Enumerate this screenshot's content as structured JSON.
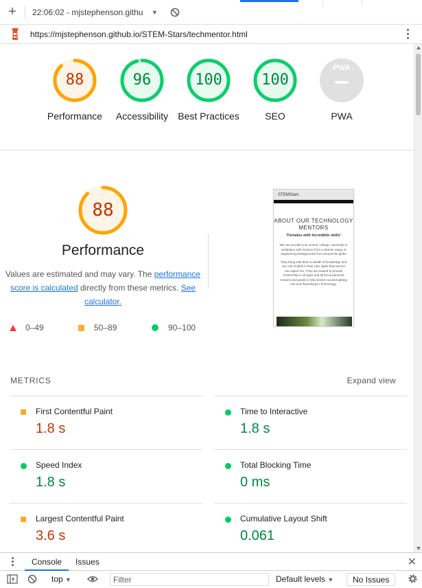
{
  "colors": {
    "orange": "#ffa400",
    "green": "#0cce6b",
    "grey": "#e0e0e0",
    "blue_link": "#1a73e8"
  },
  "toolbar": {
    "add_icon": "plus-icon",
    "report_title": "22:06:02 - mjstephenson.githu",
    "clear_icon": "block-icon"
  },
  "urlbar": {
    "icon": "lighthouse-icon",
    "url": "https://mjstephenson.github.io/STEM-Stars/techmentor.html",
    "menu_icon": "kebab-icon"
  },
  "gauges": [
    {
      "label": "Performance",
      "value": "88",
      "score": 0.88,
      "status": "average"
    },
    {
      "label": "Accessibility",
      "value": "96",
      "score": 0.96,
      "status": "pass"
    },
    {
      "label": "Best Practices",
      "value": "100",
      "score": 1.0,
      "status": "pass"
    },
    {
      "label": "SEO",
      "value": "100",
      "score": 1.0,
      "status": "pass"
    },
    {
      "label": "PWA",
      "value": "PWA",
      "score": null,
      "status": "na"
    }
  ],
  "performance": {
    "score": "88",
    "title": "Performance",
    "desc_before": "Values are estimated and may vary. The ",
    "desc_link": "performance score is calculated",
    "desc_middle": " directly from these metrics. ",
    "desc_link2": "See calculator."
  },
  "legend": {
    "fail": "0–49",
    "average": "50–89",
    "pass": "90–100"
  },
  "screenshot": {
    "brand": "STEMStars",
    "heading": "ABOUT OUR TECHNOLOGY MENTORS",
    "subheading": "'Females with Incredible skills'",
    "para1": "We can provide your school, college, university or workplace with mentors from a diverse range of engineering backgrounds from around the globe",
    "para2": "They bring with them a wealth of knowledge and are role models in their own rights that women can aspire too. They are trained to provide mentorship to all ages and all focus personal reasons and goals to help women suceed getting into and flourishing in Technology."
  },
  "metrics": {
    "header": "METRICS",
    "expand": "Expand view",
    "items": [
      {
        "name": "First Contentful Paint",
        "value": "1.8 s",
        "status": "average"
      },
      {
        "name": "Time to Interactive",
        "value": "1.8 s",
        "status": "pass"
      },
      {
        "name": "Speed Index",
        "value": "1.8 s",
        "status": "pass"
      },
      {
        "name": "Total Blocking Time",
        "value": "0 ms",
        "status": "pass"
      },
      {
        "name": "Largest Contentful Paint",
        "value": "3.6 s",
        "status": "average"
      },
      {
        "name": "Cumulative Layout Shift",
        "value": "0.061",
        "status": "pass"
      }
    ]
  },
  "devtools": {
    "tabs": [
      "Console",
      "Issues"
    ],
    "context": "top",
    "filter_placeholder": "Filter",
    "levels": "Default levels",
    "issues": "No Issues"
  }
}
